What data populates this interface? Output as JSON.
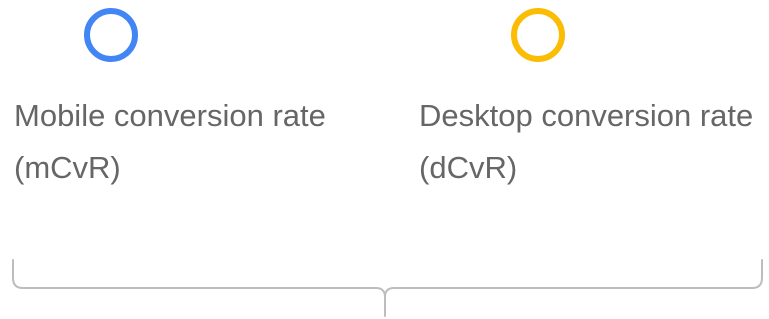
{
  "metrics": [
    {
      "id": "mobile",
      "label_line1": "Mobile conversion rate",
      "label_line2": "(mCvR)",
      "ring_color": "#4285F4"
    },
    {
      "id": "desktop",
      "label_line1": "Desktop conversion rate",
      "label_line2": "(dCvR)",
      "ring_color": "#FBBC04"
    }
  ],
  "bracket_color": "#BDBDBD"
}
